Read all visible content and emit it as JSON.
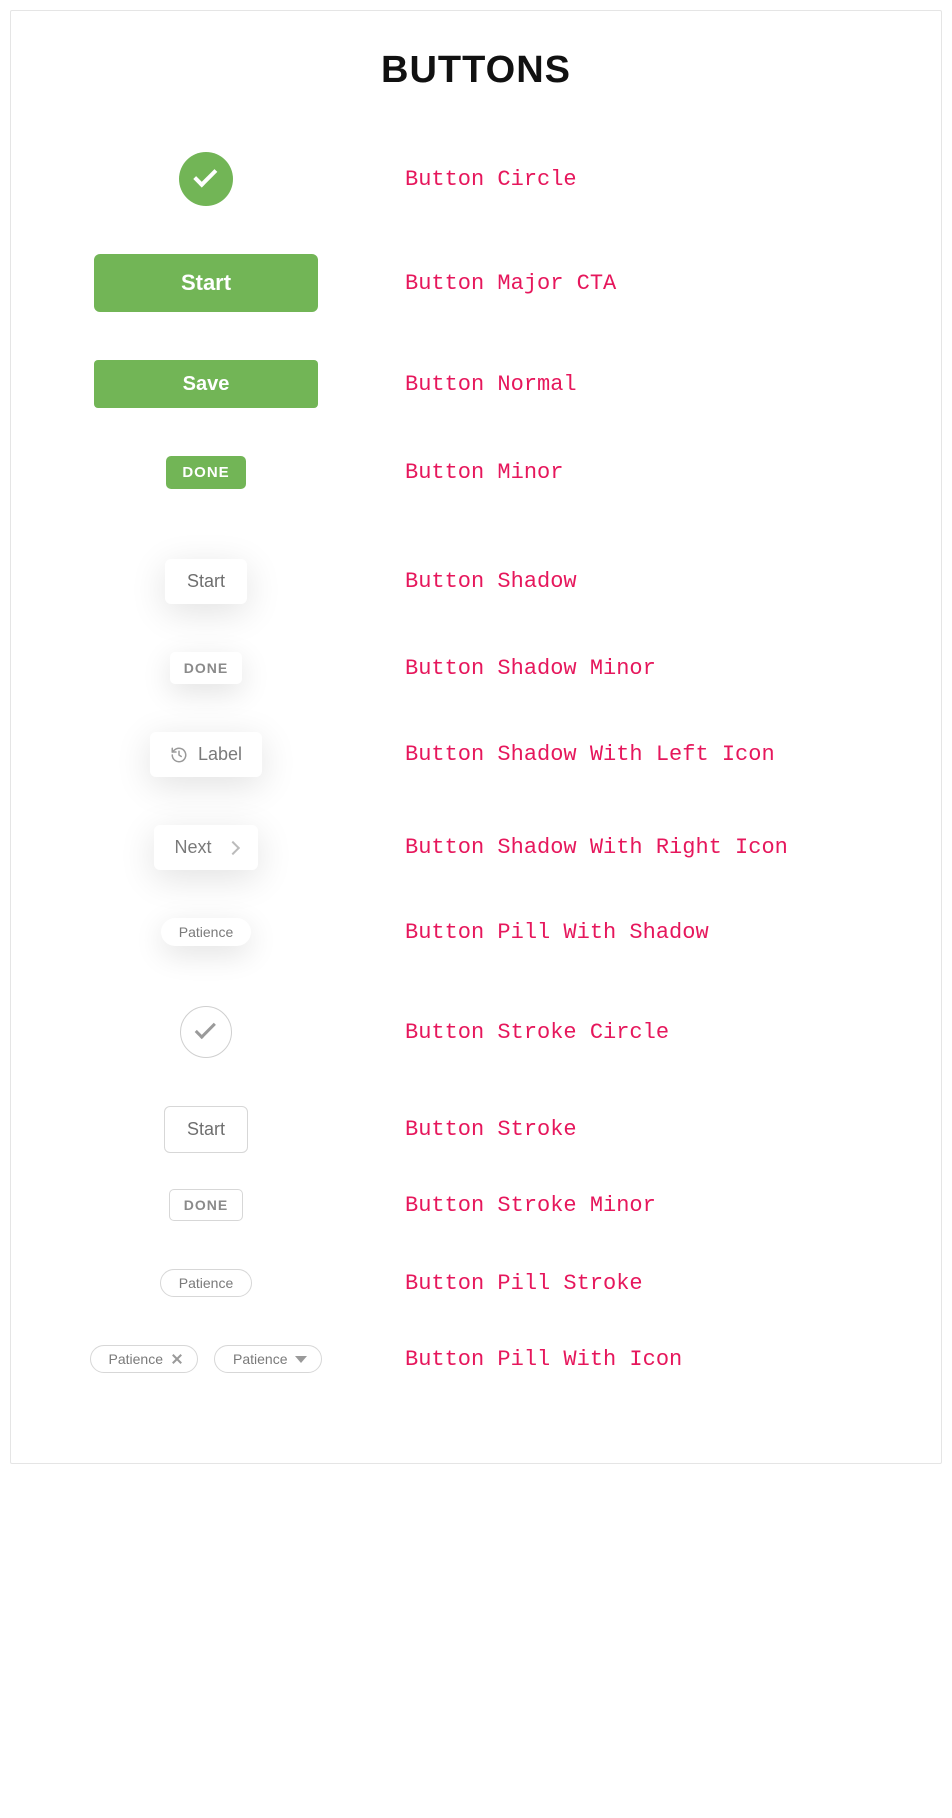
{
  "title": "BUTTONS",
  "colors": {
    "green": "#72b556",
    "label": "#e6175c",
    "grey_text": "#7a7a7a"
  },
  "rows": [
    {
      "label": "Button Circle",
      "button_text": ""
    },
    {
      "label": "Button Major CTA",
      "button_text": "Start"
    },
    {
      "label": "Button Normal",
      "button_text": "Save"
    },
    {
      "label": "Button Minor",
      "button_text": "DONE"
    },
    {
      "label": "Button Shadow",
      "button_text": "Start"
    },
    {
      "label": "Button Shadow Minor",
      "button_text": "DONE"
    },
    {
      "label": "Button Shadow With Left Icon",
      "button_text": "Label",
      "icon": "history-icon"
    },
    {
      "label": "Button Shadow With Right Icon",
      "button_text": "Next",
      "icon": "chevron-right-icon"
    },
    {
      "label": "Button Pill With Shadow",
      "button_text": "Patience"
    },
    {
      "label": "Button Stroke Circle",
      "button_text": ""
    },
    {
      "label": "Button Stroke",
      "button_text": "Start"
    },
    {
      "label": "Button Stroke Minor",
      "button_text": "DONE"
    },
    {
      "label": "Button Pill Stroke",
      "button_text": "Patience"
    },
    {
      "label": "Button Pill With Icon",
      "button_text_a": "Patience",
      "button_text_b": "Patience",
      "icon_a": "close-icon",
      "icon_b": "caret-down-icon"
    }
  ]
}
